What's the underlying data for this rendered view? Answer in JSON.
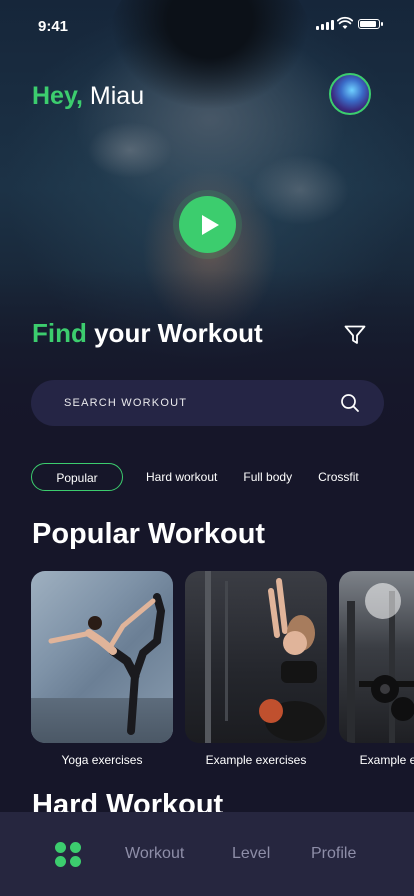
{
  "status_bar": {
    "time": "9:41"
  },
  "header": {
    "greeting": "Hey,",
    "name": "Miau"
  },
  "hero": {
    "title_highlight": "Find",
    "title_rest": " your Workout"
  },
  "search": {
    "placeholder": "SEARCH WORKOUT"
  },
  "filters": [
    {
      "label": "Popular",
      "active": true
    },
    {
      "label": "Hard workout",
      "active": false
    },
    {
      "label": "Full body",
      "active": false
    },
    {
      "label": "Crossfit",
      "active": false
    }
  ],
  "popular": {
    "title": "Popular Workout",
    "cards": [
      {
        "caption": "Yoga exercises"
      },
      {
        "caption": "Example exercises"
      },
      {
        "caption": "Example exercises"
      }
    ]
  },
  "hard": {
    "title": "Hard Workout"
  },
  "tabbar": {
    "home_icon": "grid-dots-icon",
    "items": [
      {
        "label": "Workout"
      },
      {
        "label": "Level"
      },
      {
        "label": "Profile"
      }
    ]
  },
  "colors": {
    "accent": "#3ccd6e",
    "background": "#161629",
    "surface": "#252545",
    "tabbar": "#26263f"
  }
}
